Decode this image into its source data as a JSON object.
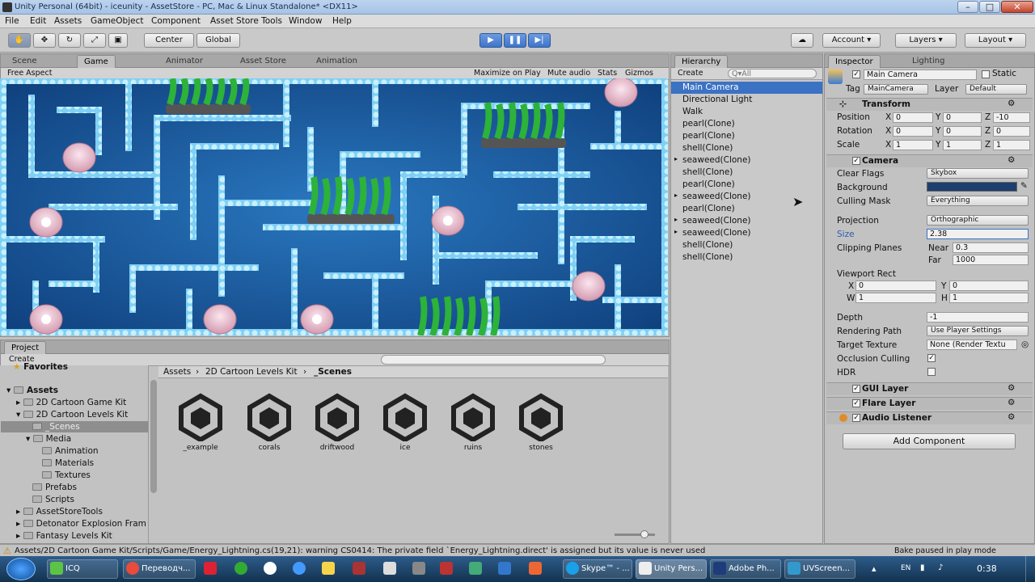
{
  "window": {
    "title": "Unity Personal (64bit) - iceunity - AssetStore - PC, Mac & Linux Standalone* <DX11>"
  },
  "menu": [
    "File",
    "Edit",
    "Assets",
    "GameObject",
    "Component",
    "Asset Store Tools",
    "Window",
    "Help"
  ],
  "toolbar": {
    "center": "Center",
    "global": "Global",
    "account": "Account",
    "layers": "Layers",
    "layout": "Layout"
  },
  "left_tabs": [
    "Scene",
    "Game",
    "Animator",
    "Asset Store",
    "Animation"
  ],
  "game_bar": {
    "aspect": "Free Aspect",
    "maximize": "Maximize on Play",
    "mute": "Mute audio",
    "stats": "Stats",
    "gizmos": "Gizmos"
  },
  "hierarchy": {
    "tab": "Hierarchy",
    "create": "Create",
    "search": "Q▾All",
    "items": [
      "Main Camera",
      "Directional Light",
      "Walk",
      "pearl(Clone)",
      "pearl(Clone)",
      "shell(Clone)",
      "seaweed(Clone)",
      "shell(Clone)",
      "pearl(Clone)",
      "seaweed(Clone)",
      "pearl(Clone)",
      "seaweed(Clone)",
      "seaweed(Clone)",
      "shell(Clone)",
      "shell(Clone)"
    ]
  },
  "inspector": {
    "tabs": [
      "Inspector",
      "Lighting"
    ],
    "object_name": "Main Camera",
    "static": "Static",
    "tag_label": "Tag",
    "tag": "MainCamera",
    "layer_label": "Layer",
    "layer": "Default",
    "transform": {
      "title": "Transform",
      "position": {
        "label": "Position",
        "x": "0",
        "y": "0",
        "z": "-10"
      },
      "rotation": {
        "label": "Rotation",
        "x": "0",
        "y": "0",
        "z": "0"
      },
      "scale": {
        "label": "Scale",
        "x": "1",
        "y": "1",
        "z": "1"
      }
    },
    "camera": {
      "title": "Camera",
      "clear_flags": {
        "label": "Clear Flags",
        "value": "Skybox"
      },
      "background": {
        "label": "Background"
      },
      "culling_mask": {
        "label": "Culling Mask",
        "value": "Everything"
      },
      "projection": {
        "label": "Projection",
        "value": "Orthographic"
      },
      "size": {
        "label": "Size",
        "value": "2.38"
      },
      "clipping": {
        "label": "Clipping Planes",
        "near_label": "Near",
        "near": "0.3",
        "far_label": "Far",
        "far": "1000"
      },
      "viewport": {
        "label": "Viewport Rect",
        "x": "0",
        "y": "0",
        "w": "1",
        "h": "1"
      },
      "depth": {
        "label": "Depth",
        "value": "-1"
      },
      "rendering_path": {
        "label": "Rendering Path",
        "value": "Use Player Settings"
      },
      "target_texture": {
        "label": "Target Texture",
        "value": "None (Render Textu"
      },
      "occlusion": {
        "label": "Occlusion Culling"
      },
      "hdr": {
        "label": "HDR"
      }
    },
    "components": [
      "GUI Layer",
      "Flare Layer",
      "Audio Listener"
    ],
    "add_component": "Add Component"
  },
  "project": {
    "tab": "Project",
    "create": "Create",
    "favorites": "Favorites",
    "tree": [
      {
        "label": "Assets",
        "indent": 0
      },
      {
        "label": "2D Cartoon Game Kit",
        "indent": 1
      },
      {
        "label": "2D Cartoon Levels Kit",
        "indent": 1
      },
      {
        "label": "_Scenes",
        "indent": 2
      },
      {
        "label": "Media",
        "indent": 2
      },
      {
        "label": "Animation",
        "indent": 3
      },
      {
        "label": "Materials",
        "indent": 3
      },
      {
        "label": "Textures",
        "indent": 3
      },
      {
        "label": "Prefabs",
        "indent": 2
      },
      {
        "label": "Scripts",
        "indent": 2
      },
      {
        "label": "AssetStoreTools",
        "indent": 1
      },
      {
        "label": "Detonator Explosion Fram",
        "indent": 1
      },
      {
        "label": "Fantasy Levels Kit",
        "indent": 1
      }
    ],
    "breadcrumb": [
      "Assets",
      "2D Cartoon Levels Kit",
      "_Scenes"
    ],
    "assets": [
      "_example",
      "corals",
      "driftwood",
      "ice",
      "ruins",
      "stones"
    ]
  },
  "status": {
    "message": "Assets/2D Cartoon Game Kit/Scripts/Game/Energy_Lightning.cs(19,21): warning CS0414: The private field `Energy_Lightning.direct' is assigned but its value is never used",
    "bake": "Bake paused in play mode"
  },
  "taskbar": {
    "items": [
      "ICQ",
      "Переводч...",
      "",
      "",
      "",
      "",
      "",
      "",
      "Skype™ - ...",
      "Unity Pers...",
      "Adobe Ph...",
      "UVScreen..."
    ],
    "lang": "EN",
    "time": "0:38"
  },
  "colors": {
    "accent": "#3f74c8",
    "background_color": "#1d3f6e",
    "selection": "#3b72c4"
  }
}
